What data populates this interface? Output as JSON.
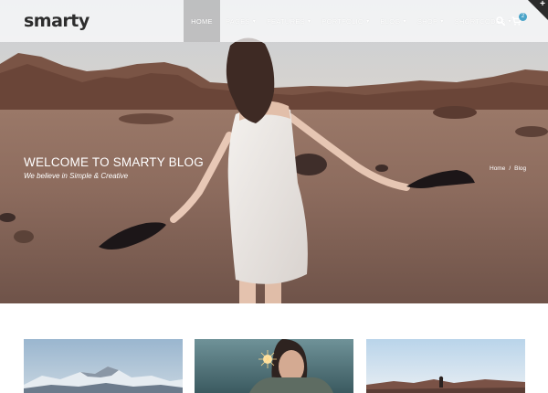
{
  "brand": {
    "logo_text": "smarty"
  },
  "nav": {
    "items": [
      {
        "label": "HOME",
        "active": true,
        "caret": false
      },
      {
        "label": "PAGES",
        "caret": true
      },
      {
        "label": "FEATURES",
        "caret": true
      },
      {
        "label": "PORTFOLIO",
        "caret": true
      },
      {
        "label": "BLOG",
        "caret": true
      },
      {
        "label": "SHOP",
        "caret": true
      },
      {
        "label": "SHORTCODES",
        "caret": true
      }
    ],
    "caret_glyph": "▾"
  },
  "header_actions": {
    "search_icon": "search-icon",
    "cart_icon": "cart-icon",
    "cart_count": "2"
  },
  "hero": {
    "title": "WELCOME TO SMARTY BLOG",
    "subtitle": "We believe in Simple & Creative"
  },
  "breadcrumb": {
    "home": "Home",
    "separator": "/",
    "current": "Blog"
  },
  "colors": {
    "accent": "#4aa3c8",
    "logo": "#2d2d2d",
    "corner": "#2b2b2b"
  }
}
